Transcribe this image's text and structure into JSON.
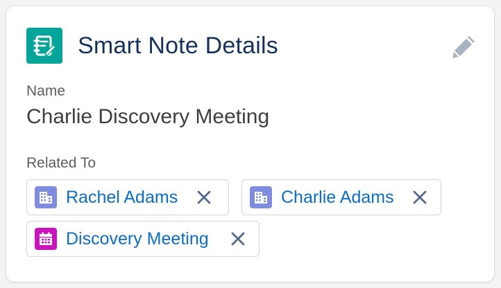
{
  "header": {
    "title": "Smart Note Details",
    "icon": "smart-note-icon",
    "icon_color": "#06a59a",
    "edit_icon": "pencil-icon"
  },
  "fields": {
    "name_label": "Name",
    "name_value": "Charlie Discovery Meeting",
    "related_label": "Related To"
  },
  "related": [
    {
      "label": "Rachel Adams",
      "icon": "account-icon",
      "icon_color": "#7f8de1",
      "remove_icon": "close-icon"
    },
    {
      "label": "Charlie Adams",
      "icon": "account-icon",
      "icon_color": "#7f8de1",
      "remove_icon": "close-icon"
    },
    {
      "label": "Discovery Meeting",
      "icon": "event-icon",
      "icon_color": "#cb14bf",
      "remove_icon": "close-icon"
    }
  ],
  "colors": {
    "title": "#16325c",
    "link": "#0b6dc8",
    "label": "#5e5e5e",
    "value": "#3e3e3c"
  }
}
